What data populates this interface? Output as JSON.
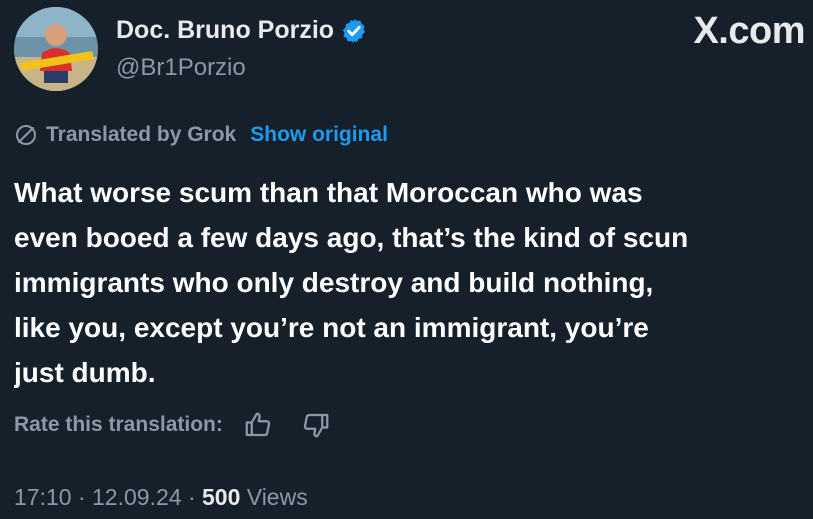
{
  "brand": "X.com",
  "author": {
    "name": "Doc. Bruno Porzio",
    "handle": "@Br1Porzio",
    "verified": true
  },
  "translation": {
    "label": "Translated by Grok",
    "show_original": "Show original"
  },
  "tweet": {
    "lines": [
      "What worse scum than that Moroccan who was",
      "even booed a few days ago, that’s the kind of scun",
      "immigrants who only destroy and build nothing,",
      "like you, except you’re not an immigrant, you’re",
      "just dumb."
    ]
  },
  "rating": {
    "label": "Rate this translation:"
  },
  "meta": {
    "time": "17:10",
    "separator": "·",
    "date": "12.09.24",
    "views_count": "500",
    "views_label": "Views"
  },
  "colors": {
    "background": "#15202b",
    "accent": "#1d9bf0",
    "secondary_text": "#8b98a5"
  }
}
